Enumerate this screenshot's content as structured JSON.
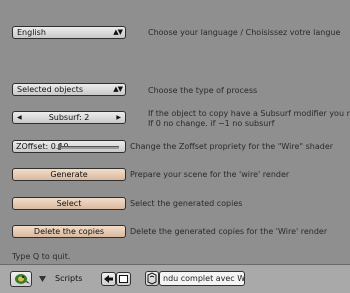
{
  "language": {
    "select_value": "English",
    "description": "Choose your language / Choisissez votre langue"
  },
  "process": {
    "select_value": "Selected objects",
    "description": "Choose the type of process"
  },
  "subsurf": {
    "label": "Subsurf: 2",
    "description_line1": "If the object to copy have a Subsurf modifier you m",
    "description_line2": "If 0 no change. if −1 no subsurf"
  },
  "zoffset": {
    "label": "ZOffset: 0.10",
    "description": "Change the Zoffset propriety for the \"Wire\" shader"
  },
  "generate": {
    "label": "Generate",
    "description": "Prepare your scene for the 'wire' render"
  },
  "select": {
    "label": "Select",
    "description": "Select the generated copies"
  },
  "delete_copies": {
    "label": "Delete the copies",
    "description": "Delete the generated copies for the 'Wire' render"
  },
  "quit_hint": "Type Q to quit.",
  "header": {
    "window_type_icon": "python-icon",
    "menu_label": "Scripts",
    "arrow_icon": "left-arrow-icon",
    "fullscreen_icon": "window-icon",
    "script_icon": "script-icon",
    "script_name": "ndu complet avec W"
  }
}
